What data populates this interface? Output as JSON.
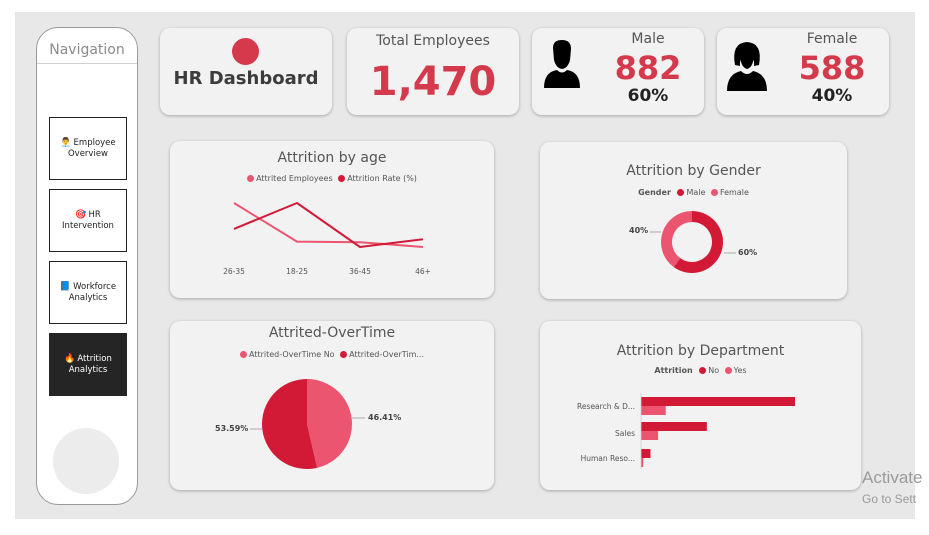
{
  "colors": {
    "accent_red": "#d21a36",
    "light_red": "#ec5570",
    "kpi_red": "#d43a4b"
  },
  "navigation": {
    "title": "Navigation",
    "items": [
      {
        "icon": "👨‍💼",
        "label": "Employee Overview",
        "icon_name": "employee-icon"
      },
      {
        "icon": "🎯",
        "label": "HR Intervention",
        "icon_name": "target-icon"
      },
      {
        "icon": "📘",
        "label": "Workforce Analytics",
        "icon_name": "book-icon"
      },
      {
        "icon": "🔥",
        "label": "Attrition Analytics",
        "icon_name": "fire-icon",
        "active": true
      }
    ]
  },
  "header": {
    "title": "HR Dashboard"
  },
  "kpis": {
    "total": {
      "label": "Total Employees",
      "value": "1,470"
    },
    "male": {
      "label": "Male",
      "value": "882",
      "pct": "60%"
    },
    "female": {
      "label": "Female",
      "value": "588",
      "pct": "40%"
    }
  },
  "charts": {
    "age": {
      "title": "Attrition by age",
      "legend": [
        "Attrited Employees",
        "Attrition Rate (%)"
      ],
      "categories": [
        "26-35",
        "18-25",
        "36-45",
        "46+"
      ]
    },
    "gender": {
      "title": "Attrition by Gender",
      "legend_title": "Gender",
      "legend": [
        "Male",
        "Female"
      ],
      "labels": [
        "40%",
        "60%"
      ]
    },
    "overtime": {
      "title": "Attrited-OverTime",
      "legend": [
        "Attrited-OverTime No",
        "Attrited-OverTim..."
      ],
      "labels": [
        "53.59%",
        "46.41%"
      ]
    },
    "department": {
      "title": "Attrition by Department",
      "legend_title": "Attrition",
      "legend": [
        "No",
        "Yes"
      ],
      "categories": [
        "Research & D...",
        "Sales",
        "Human Reso..."
      ]
    }
  },
  "chart_data": [
    {
      "type": "line",
      "title": "Attrition by age",
      "categories": [
        "26-35",
        "18-25",
        "36-45",
        "46+"
      ],
      "series": [
        {
          "name": "Attrited Employees",
          "values": [
            116,
            44,
            43,
            34
          ]
        },
        {
          "name": "Attrition Rate (%)",
          "values": [
            20,
            40,
            6,
            12
          ]
        }
      ]
    },
    {
      "type": "pie",
      "title": "Attrition by Gender",
      "categories": [
        "Male",
        "Female"
      ],
      "values": [
        60,
        40
      ],
      "donut": true
    },
    {
      "type": "pie",
      "title": "Attrited-OverTime",
      "categories": [
        "Attrited-OverTime No",
        "Attrited-OverTim..."
      ],
      "values": [
        53.59,
        46.41
      ]
    },
    {
      "type": "bar",
      "orientation": "horizontal",
      "title": "Attrition by Department",
      "categories": [
        "Research & D...",
        "Sales",
        "Human Reso..."
      ],
      "series": [
        {
          "name": "No",
          "values": [
            828,
            354,
            51
          ]
        },
        {
          "name": "Yes",
          "values": [
            133,
            92,
            12
          ]
        }
      ]
    }
  ],
  "watermark": {
    "line1": "Activate",
    "line2": "Go to Sett"
  }
}
